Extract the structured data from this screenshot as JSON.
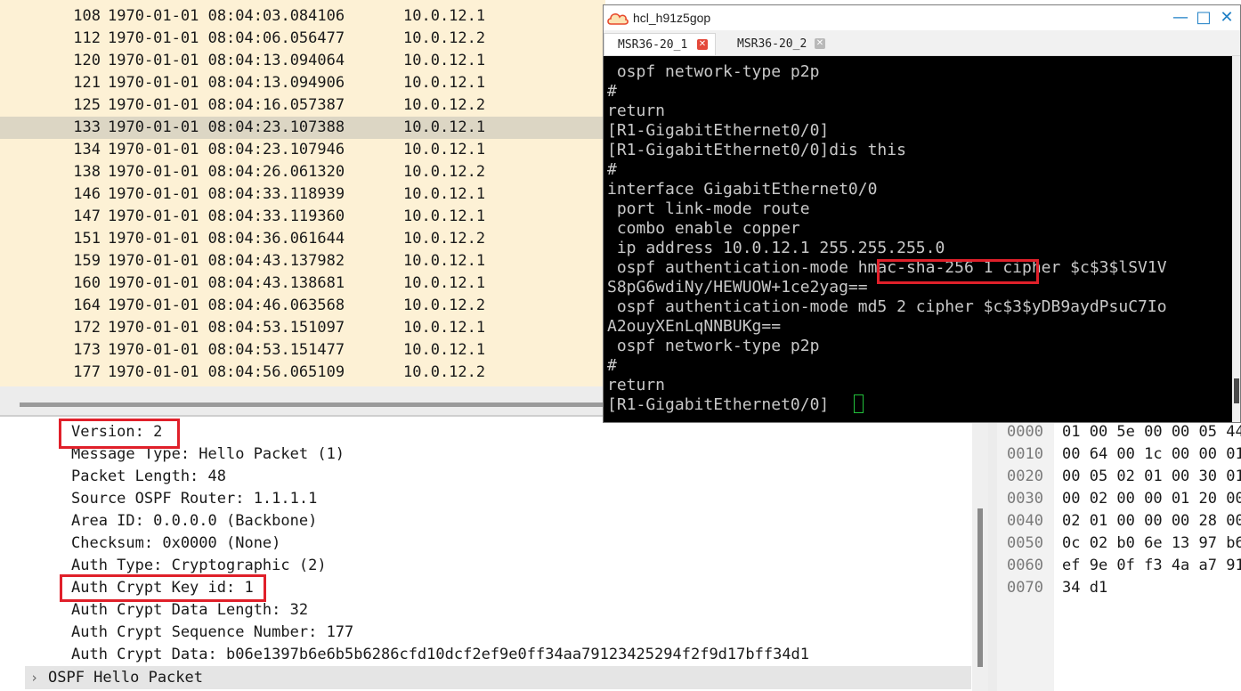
{
  "packet_list": {
    "rows": [
      {
        "no": "108",
        "time": "1970-01-01 08:04:03.084106",
        "source": "10.0.12.1",
        "selected": false
      },
      {
        "no": "112",
        "time": "1970-01-01 08:04:06.056477",
        "source": "10.0.12.2",
        "selected": false
      },
      {
        "no": "120",
        "time": "1970-01-01 08:04:13.094064",
        "source": "10.0.12.1",
        "selected": false
      },
      {
        "no": "121",
        "time": "1970-01-01 08:04:13.094906",
        "source": "10.0.12.1",
        "selected": false
      },
      {
        "no": "125",
        "time": "1970-01-01 08:04:16.057387",
        "source": "10.0.12.2",
        "selected": false
      },
      {
        "no": "133",
        "time": "1970-01-01 08:04:23.107388",
        "source": "10.0.12.1",
        "selected": true
      },
      {
        "no": "134",
        "time": "1970-01-01 08:04:23.107946",
        "source": "10.0.12.1",
        "selected": false
      },
      {
        "no": "138",
        "time": "1970-01-01 08:04:26.061320",
        "source": "10.0.12.2",
        "selected": false
      },
      {
        "no": "146",
        "time": "1970-01-01 08:04:33.118939",
        "source": "10.0.12.1",
        "selected": false
      },
      {
        "no": "147",
        "time": "1970-01-01 08:04:33.119360",
        "source": "10.0.12.1",
        "selected": false
      },
      {
        "no": "151",
        "time": "1970-01-01 08:04:36.061644",
        "source": "10.0.12.2",
        "selected": false
      },
      {
        "no": "159",
        "time": "1970-01-01 08:04:43.137982",
        "source": "10.0.12.1",
        "selected": false
      },
      {
        "no": "160",
        "time": "1970-01-01 08:04:43.138681",
        "source": "10.0.12.1",
        "selected": false
      },
      {
        "no": "164",
        "time": "1970-01-01 08:04:46.063568",
        "source": "10.0.12.2",
        "selected": false
      },
      {
        "no": "172",
        "time": "1970-01-01 08:04:53.151097",
        "source": "10.0.12.1",
        "selected": false
      },
      {
        "no": "173",
        "time": "1970-01-01 08:04:53.151477",
        "source": "10.0.12.1",
        "selected": false
      },
      {
        "no": "177",
        "time": "1970-01-01 08:04:56.065109",
        "source": "10.0.12.2",
        "selected": false
      }
    ]
  },
  "details": {
    "lines": [
      "Version: 2",
      "Message Type: Hello Packet (1)",
      "Packet Length: 48",
      "Source OSPF Router: 1.1.1.1",
      "Area ID: 0.0.0.0 (Backbone)",
      "Checksum: 0x0000 (None)",
      "Auth Type: Cryptographic (2)",
      "Auth Crypt Key id: 1",
      "Auth Crypt Data Length: 32",
      "Auth Crypt Sequence Number: 177",
      "Auth Crypt Data: b06e1397b6e6b5b6286cfd10dcf2ef9e0ff34aa79123425294f2f9d17bff34d1"
    ],
    "highlighted": [
      "Version: 2",
      "Auth Crypt Key id: 1"
    ],
    "collapsed_node": {
      "chevron": "›",
      "label": "OSPF Hello Packet"
    }
  },
  "hex": {
    "rows": [
      {
        "offset": "0000",
        "bytes": "01 00 5e 00 00 05 44"
      },
      {
        "offset": "0010",
        "bytes": "00 64 00 1c 00 00 01"
      },
      {
        "offset": "0020",
        "bytes": "00 05 02 01 00 30 01"
      },
      {
        "offset": "0030",
        "bytes": "00 02 00 00 01 20 00"
      },
      {
        "offset": "0040",
        "bytes": "02 01 00 00 00 28 00"
      },
      {
        "offset": "0050",
        "bytes": "0c 02 b0 6e 13 97 b6"
      },
      {
        "offset": "0060",
        "bytes": "ef 9e 0f f3 4a a7 91"
      },
      {
        "offset": "0070",
        "bytes": "34 d1"
      }
    ]
  },
  "terminal_window": {
    "title": "hcl_h91z5gop",
    "controls": {
      "minimize": "—",
      "maximize": "□",
      "close": "✕"
    },
    "tabs": [
      {
        "label": "MSR36-20_1",
        "active": true,
        "close": "✕"
      },
      {
        "label": "MSR36-20_2",
        "active": false,
        "close": "✕"
      }
    ],
    "lines": [
      " ospf network-type p2p",
      "#",
      "return",
      "[R1-GigabitEthernet0/0]",
      "[R1-GigabitEthernet0/0]dis this",
      "#",
      "interface GigabitEthernet0/0",
      " port link-mode route",
      " combo enable copper",
      " ip address 10.0.12.1 255.255.255.0",
      " ospf authentication-mode hmac-sha-256 1 cipher $c$3$lSV1V",
      "S8pG6wdiNy/HEWUOW+1ce2yag==",
      " ospf authentication-mode md5 2 cipher $c$3$yDB9aydPsuC7Io",
      "A2ouyXEnLqNNBUKg==",
      " ospf network-type p2p",
      "#",
      "return",
      "[R1-GigabitEthernet0/0]"
    ],
    "highlighted_text": "hmac-sha-256 1",
    "colors": {
      "background": "#000000",
      "text": "#c8c8c8",
      "cursor": "#22c13b",
      "highlight_box": "#e0202a"
    }
  }
}
